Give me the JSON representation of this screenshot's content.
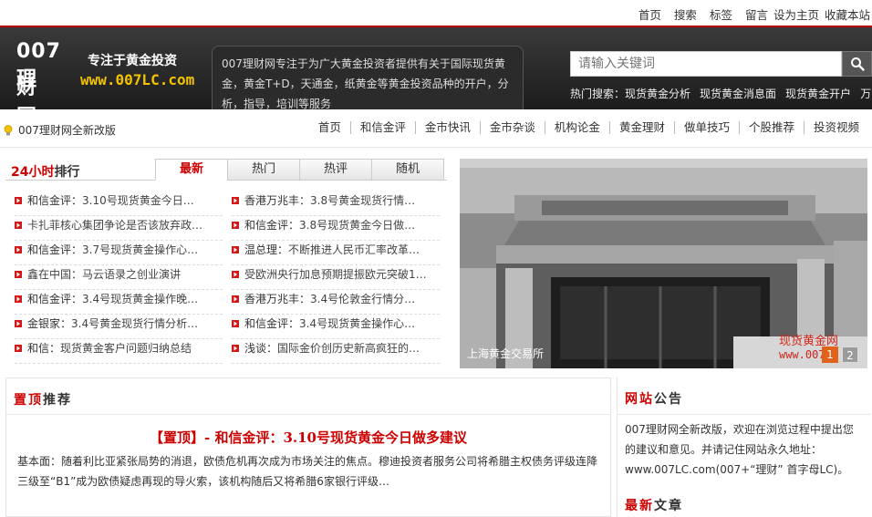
{
  "top_links": [
    "首页",
    "搜索",
    "标签",
    "留言",
    "设为主页",
    "收藏本站"
  ],
  "header": {
    "logo_line1": "007理",
    "logo_line2": "财网",
    "slogan": "专注于黄金投资",
    "url": "www.007LC.com",
    "description": "007理财网专注于为广大黄金投资者提供有关于国际现货黄金，黄金T+D，天通金，纸黄金等黄金投资品种的开户，分析，指导，培训等服务",
    "search_placeholder": "请输入关键词",
    "hot_search_label": "热门搜索：",
    "hot_search_items": [
      "现货黄金分析",
      "现货黄金消息面",
      "现货黄金开户",
      "万"
    ]
  },
  "nav": {
    "notice": "007理财网全新改版",
    "items": [
      "首页",
      "和信金评",
      "金市快讯",
      "金市杂谈",
      "机构论金",
      "黄金理财",
      "做单技巧",
      "个股推荐",
      "投资视频"
    ]
  },
  "ranking": {
    "title_hl": "24小时",
    "title_rest": "排行",
    "tabs": [
      "最新",
      "热门",
      "热评",
      "随机"
    ],
    "left_items": [
      {
        "src": "和信金评：",
        "text": "3.10号现货黄金今日…"
      },
      {
        "src": "",
        "text": "卡扎菲核心集团争论是否该放弃政…"
      },
      {
        "src": "和信金评：",
        "text": "3.7号现货黄金操作心…"
      },
      {
        "src": "",
        "text": "鑫在中国：马云语录之创业演讲"
      },
      {
        "src": "和信金评：",
        "text": "3.4号现货黄金操作晚…"
      },
      {
        "src": "金银家：",
        "text": "3.4号黄金现货行情分析…"
      },
      {
        "src": "和信：",
        "text": "现货黄金客户问题归纳总结"
      }
    ],
    "right_items": [
      {
        "src": "香港万兆丰：",
        "text": "3.8号黄金现货行情…"
      },
      {
        "src": "和信金评：",
        "text": "3.8号现货黄金今日做…"
      },
      {
        "src": "温总理：",
        "text": "不断推进人民币汇率改革…"
      },
      {
        "src": "",
        "text": "受欧洲央行加息预期提振欧元突破1…"
      },
      {
        "src": "香港万兆丰：",
        "text": "3.4号伦敦金行情分…"
      },
      {
        "src": "和信金评：",
        "text": "3.4号现货黄金操作心…"
      },
      {
        "src": "浅谈：",
        "text": "国际金价创历史新高疯狂的…"
      }
    ]
  },
  "photo": {
    "caption": "上海黄金交易所",
    "watermark_line1": "现货黄金网",
    "watermark_line2": "www.007LC",
    "pages": [
      "1",
      "2"
    ]
  },
  "sticky": {
    "title_hl": "置顶",
    "title_rest": "推荐",
    "headline": "【置顶】- 和信金评：3.10号现货黄金今日做多建议",
    "body": "基本面：随着利比亚紧张局势的消退，欧债危机再次成为市场关注的焦点。穆迪投资者服务公司将希腊主权债务评级连降三级至“B1”成为欧债疑虑再现的导火索，该机构随后又将希腊6家银行评级…"
  },
  "announce": {
    "title_hl": "网站",
    "title_rest": "公告",
    "body": "007理财网全新改版，欢迎在浏览过程中提出您的建议和意见。并请记住网站永久地址：www.007LC.com(007+“理财” 首字母LC)。",
    "latest_hl": "最新",
    "latest_rest": "文章"
  },
  "colors": {
    "accent_red": "#cc0000",
    "header_dark": "#2b2b2b",
    "url_yellow": "#f3c300",
    "pager_active": "#e0621b"
  }
}
